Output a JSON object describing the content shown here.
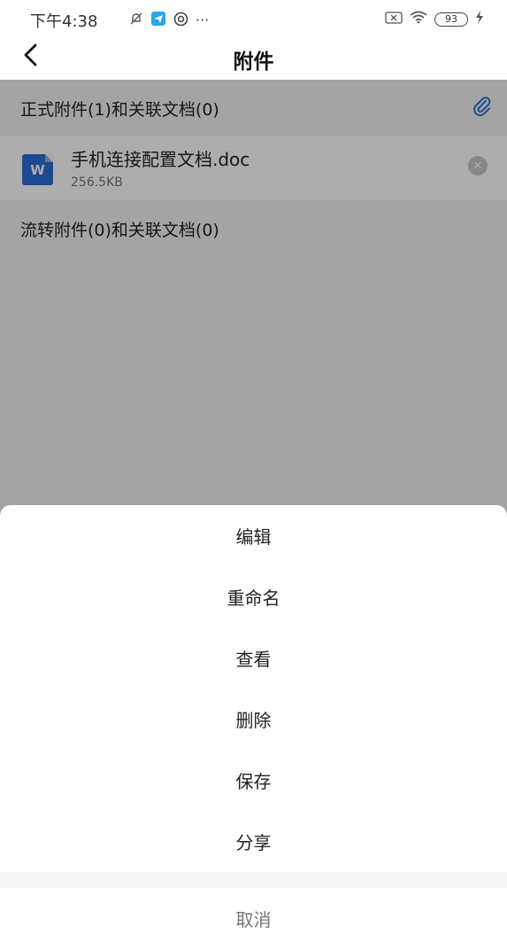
{
  "status_bar": {
    "time": "下午4:38",
    "battery": "93",
    "dots": "···"
  },
  "nav": {
    "title": "附件"
  },
  "formal_section": {
    "title": "正式附件(1)和关联文档(0)",
    "files": [
      {
        "name": "手机连接配置文档.doc",
        "size": "256.5KB",
        "icon_letter": "W"
      }
    ]
  },
  "flow_section": {
    "title": "流转附件(0)和关联文档(0)"
  },
  "action_sheet": {
    "items": [
      "编辑",
      "重命名",
      "查看",
      "删除",
      "保存",
      "分享"
    ],
    "cancel": "取消"
  },
  "colors": {
    "accent": "#2f6fd8",
    "word_icon": "#2b6cd6"
  }
}
